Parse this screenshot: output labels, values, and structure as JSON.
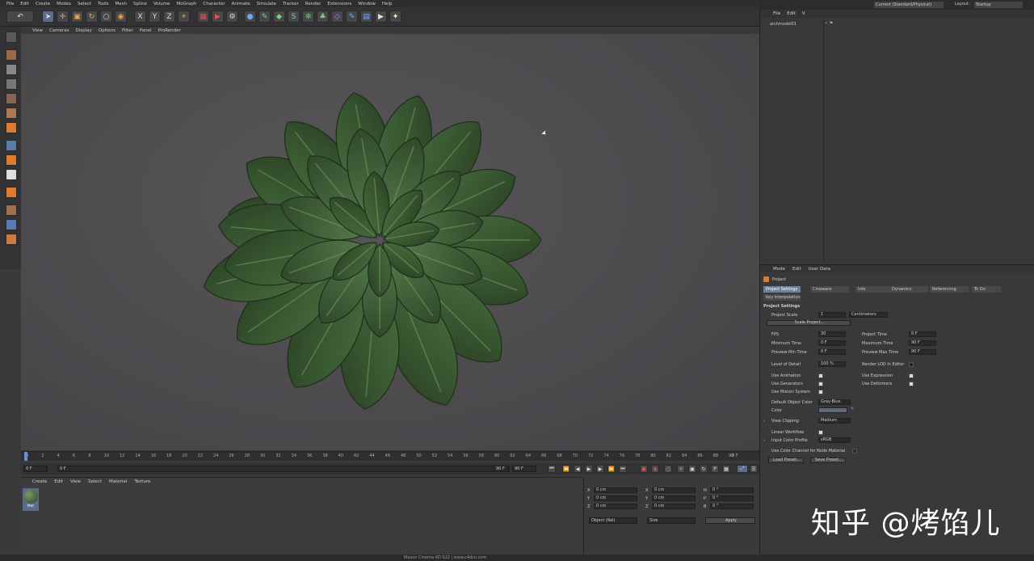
{
  "menubar": [
    "File",
    "Edit",
    "Create",
    "Modes",
    "Select",
    "Tools",
    "Mesh",
    "Spline",
    "Volume",
    "MoGraph",
    "Character",
    "Animate",
    "Simulate",
    "Tracker",
    "Render",
    "Extensions",
    "Window",
    "Help"
  ],
  "viewport_menu": [
    "View",
    "Cameras",
    "Display",
    "Options",
    "Filter",
    "Panel",
    "ProRender"
  ],
  "top_right": {
    "layout_value": "Current (Standard/Physical)",
    "layout_label": "Layout:",
    "layout_name": "Startup"
  },
  "object_manager": {
    "menu": [
      "File",
      "Edit",
      "V"
    ],
    "object_name": "archmodel01"
  },
  "timeline": {
    "ticks": [
      "0",
      "2",
      "4",
      "6",
      "8",
      "10",
      "12",
      "14",
      "16",
      "18",
      "20",
      "22",
      "24",
      "26",
      "28",
      "30",
      "32",
      "34",
      "36",
      "38",
      "40",
      "42",
      "44",
      "46",
      "48",
      "50",
      "52",
      "54",
      "56",
      "58",
      "60",
      "62",
      "64",
      "66",
      "68",
      "70",
      "72",
      "74",
      "76",
      "78",
      "80",
      "82",
      "84",
      "86",
      "88",
      "90"
    ],
    "end": "0 F"
  },
  "transport": {
    "current": "0 F",
    "start": "0 F",
    "range_end": "90 F",
    "end": "90 F"
  },
  "material_manager": {
    "menu": [
      "Create",
      "Edit",
      "View",
      "Select",
      "Material",
      "Texture"
    ],
    "material_name": "Mat"
  },
  "coords": {
    "rows": [
      [
        "X",
        "0 cm",
        "X",
        "0 cm",
        "H",
        "0 °"
      ],
      [
        "Y",
        "0 cm",
        "Y",
        "0 cm",
        "P",
        "0 °"
      ],
      [
        "Z",
        "0 cm",
        "Z",
        "0 cm",
        "B",
        "0 °"
      ]
    ],
    "mode": "Object (Rel)",
    "size": "Size",
    "apply": "Apply"
  },
  "attributes": {
    "menu": [
      "Mode",
      "Edit",
      "User Data"
    ],
    "title": "Project",
    "tabs": [
      "Project Settings",
      "Cineware",
      "Info",
      "Dynamics",
      "Referencing",
      "To Do"
    ],
    "tab2": "Key Interpolation",
    "section": "Project Settings",
    "project_scale_label": "Project Scale",
    "project_scale_value": "1",
    "project_scale_unit": "Centimeters",
    "scale_project_btn": "Scale Project...",
    "fps_label": "FPS",
    "fps_value": "30",
    "project_time_label": "Project Time",
    "project_time_value": "0 F",
    "min_time_label": "Minimum Time",
    "min_time_value": "0 F",
    "max_time_label": "Maximum Time",
    "max_time_value": "90 F",
    "prev_min_label": "Preview Min Time",
    "prev_min_value": "0 F",
    "prev_max_label": "Preview Max Time",
    "prev_max_value": "90 F",
    "lod_label": "Level of Detail",
    "lod_value": "100 %",
    "render_lod_label": "Render LOD in Editor",
    "use_anim": "Use Animation",
    "use_expr": "Use Expression",
    "use_gen": "Use Generators",
    "use_def": "Use Deformers",
    "use_motion": "Use Motion System",
    "default_color_label": "Default Object Color",
    "default_color_value": "Gray-Blue",
    "color_label": "Color",
    "view_clipping_label": "View Clipping",
    "view_clipping_value": "Medium",
    "linear_label": "Linear Workflow",
    "input_profile_label": "Input Color Profile",
    "input_profile_value": "sRGB",
    "node_color_label": "Use Color Channel for Node Material",
    "load_preset": "Load Preset...",
    "save_preset": "Save Preset..."
  },
  "status_bar": "Maxon Cinema 4D S22 | www.c4dcn.com",
  "watermark": "知乎 @烤馅儿",
  "colors": {
    "accent": "#6e7fa0",
    "leaf": "#3f5f36",
    "background": "#4d4b4e"
  }
}
